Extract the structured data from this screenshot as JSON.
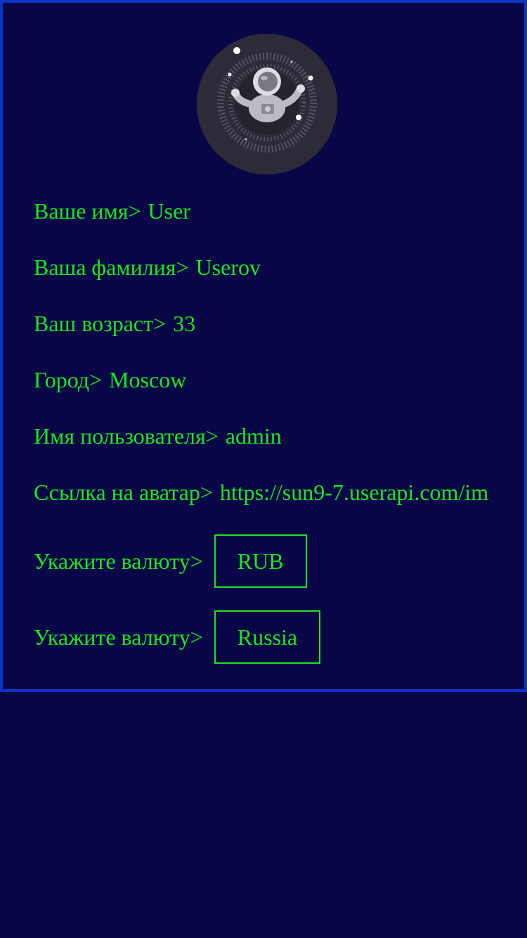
{
  "profile": {
    "avatar_icon": "astronaut-avatar",
    "fields": [
      {
        "label": "Ваше имя>",
        "value": "User"
      },
      {
        "label": "Ваша фамилия>",
        "value": "Userov"
      },
      {
        "label": "Ваш возраст>",
        "value": "33"
      },
      {
        "label": "Город>",
        "value": "Moscow"
      },
      {
        "label": "Имя пользователя>",
        "value": "admin"
      },
      {
        "label": "Ссылка на аватар>",
        "value": "https://sun9-7.userapi.com/im"
      }
    ],
    "currency": {
      "label": "Укажите валюту>",
      "value": "RUB"
    },
    "country": {
      "label": "Укажите валюту>",
      "value": "Russia"
    }
  },
  "colors": {
    "background": "#080646",
    "border": "#0b34c4",
    "text": "#18e81e",
    "avatar_bg": "#2e2b39"
  }
}
